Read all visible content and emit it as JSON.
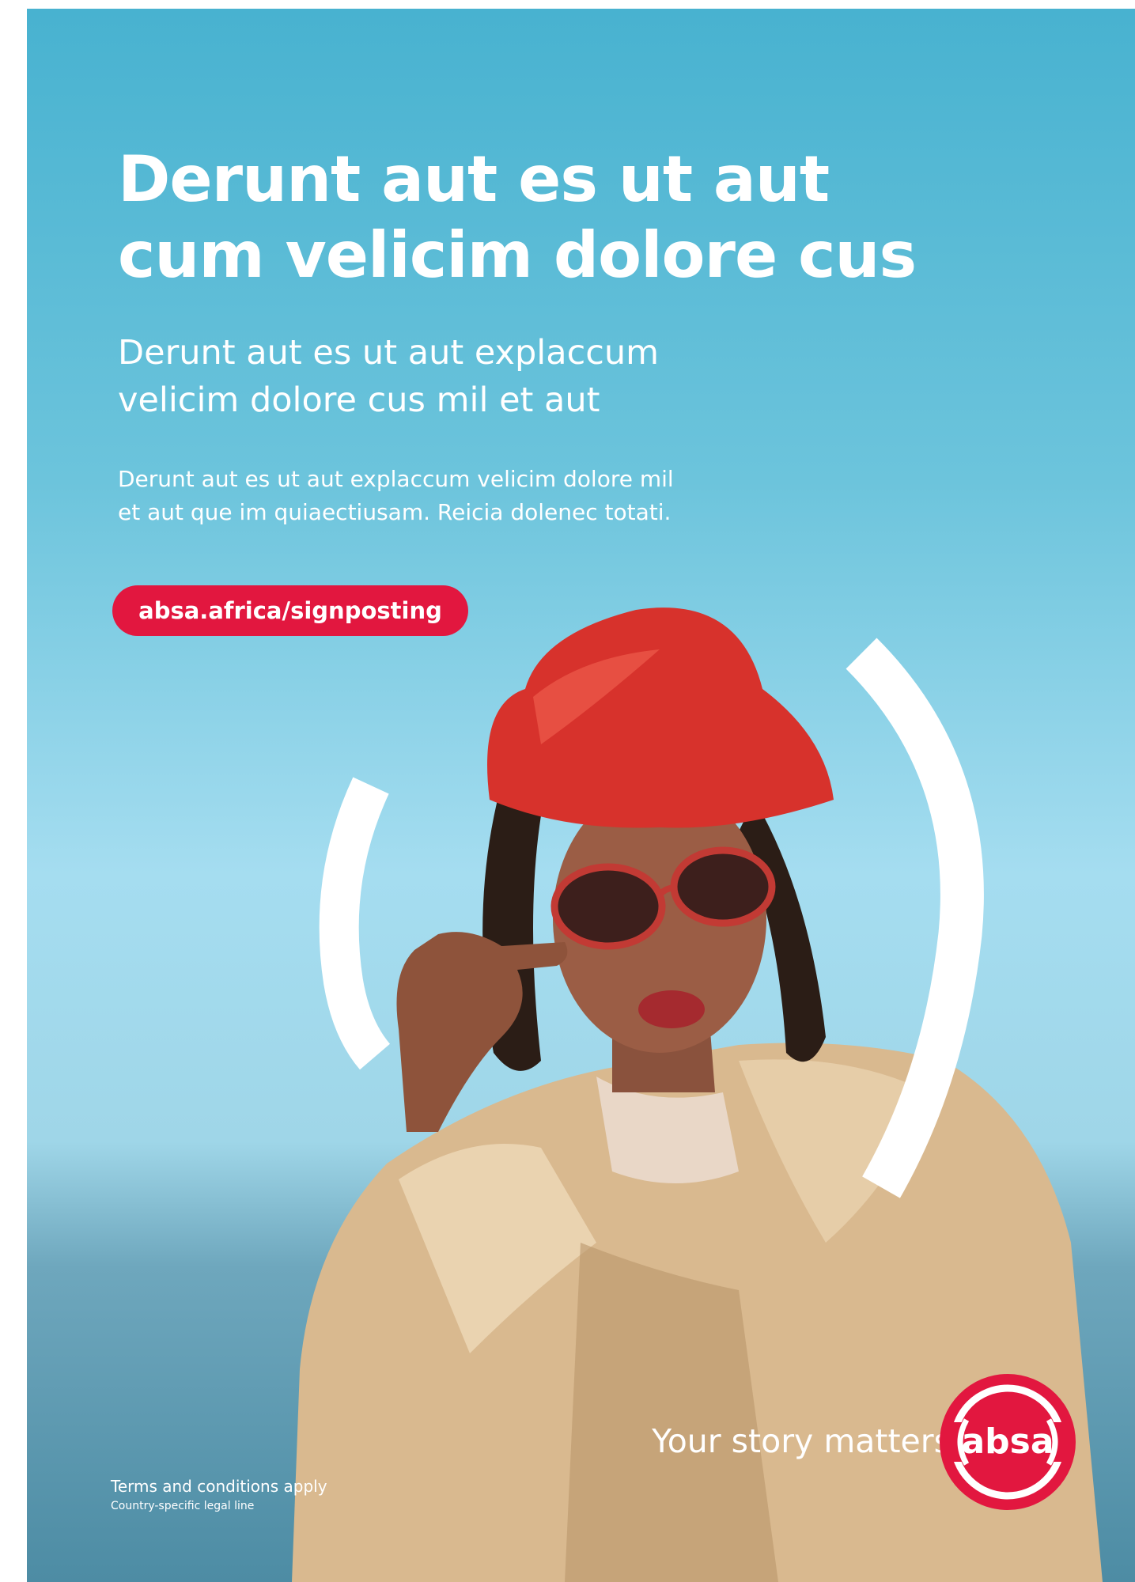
{
  "headline": {
    "line1": "Derunt aut es ut aut",
    "line2": "cum velicim dolore cus"
  },
  "subheadline": {
    "line1": "Derunt aut es ut aut explaccum",
    "line2": "velicim dolore cus mil et aut"
  },
  "body": {
    "line1": "Derunt aut es ut aut explaccum velicim dolore mil",
    "line2": "et aut que im quiaectiusam. Reicia dolenec totati."
  },
  "cta": {
    "label": "absa.africa/signposting"
  },
  "tagline": "Your story matters",
  "logo": {
    "text": "absa",
    "icon": "absa-logo-icon"
  },
  "footer": {
    "terms": "Terms and conditions apply",
    "legal": "Country-specific legal line"
  },
  "colors": {
    "brand_red": "#e2173f",
    "sky_blue": "#48b2d0",
    "text_white": "#ffffff"
  }
}
